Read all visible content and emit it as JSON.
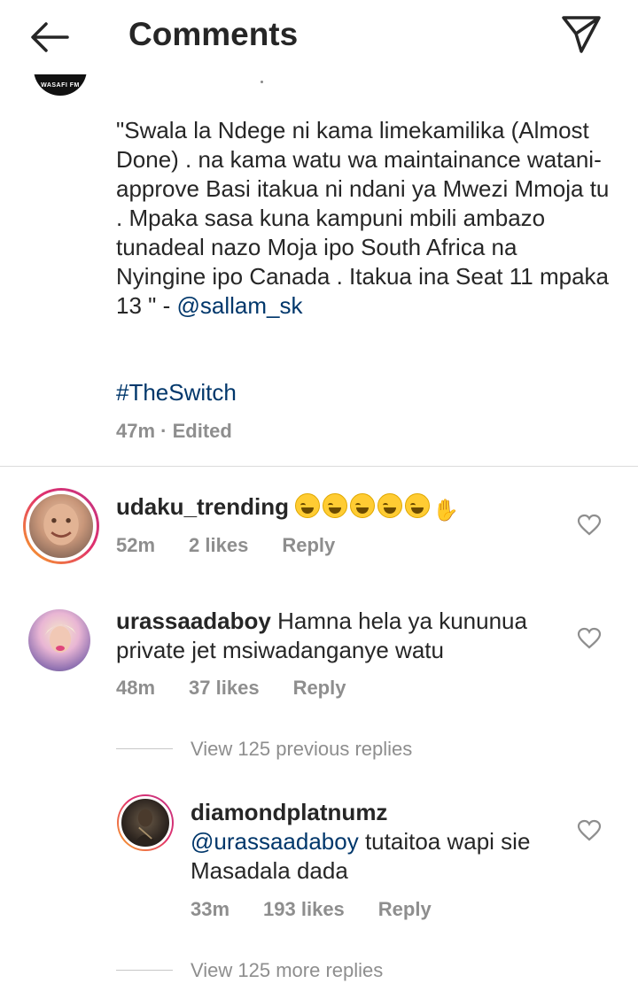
{
  "header": {
    "title": "Comments"
  },
  "post": {
    "logo_text": "WASAFI FM",
    "caption_main": "\"Swala la Ndege ni kama limekamilika (Almost Done) . na kama watu wa maintainance watani-approve Basi itakua ni ndani ya Mwezi Mmoja tu . Mpaka sasa kuna kampuni mbili ambazo tunadeal nazo Moja ipo South Africa na Nyingine ipo Canada . Itakua ina Seat 11 mpaka 13 \" - ",
    "caption_mention": "@sallam_sk",
    "hashtag": "#TheSwitch",
    "time": "47m",
    "edited": "· Edited"
  },
  "comments": [
    {
      "username": "udaku_trending",
      "text": "",
      "emoji": [
        "face-with-tears-of-joy",
        "face-with-tears-of-joy",
        "face-with-tears-of-joy",
        "face-with-tears-of-joy",
        "face-with-tears-of-joy",
        "raising-hands"
      ],
      "time": "52m",
      "likes": "2 likes",
      "reply": "Reply"
    },
    {
      "username": "urassaadaboy",
      "text": " Hamna hela ya kununua private jet msiwadanganye watu",
      "time": "48m",
      "likes": "37 likes",
      "reply": "Reply"
    }
  ],
  "thread": {
    "view_previous": "View 125 previous replies",
    "reply": {
      "username": "diamondplatnumz",
      "mention": "@urassaadaboy",
      "text": " tutaitoa wapi sie Masadala dada",
      "time": "33m",
      "likes": "193 likes",
      "reply": "Reply"
    },
    "view_more": "View 125 more replies"
  },
  "colors": {
    "link": "#00376b",
    "meta": "#8e8e8e",
    "text": "#262626",
    "story_ring": "#e1306c"
  },
  "icons": {
    "back": "arrow-left-icon",
    "send": "paper-plane-icon",
    "like": "heart-outline-icon"
  }
}
